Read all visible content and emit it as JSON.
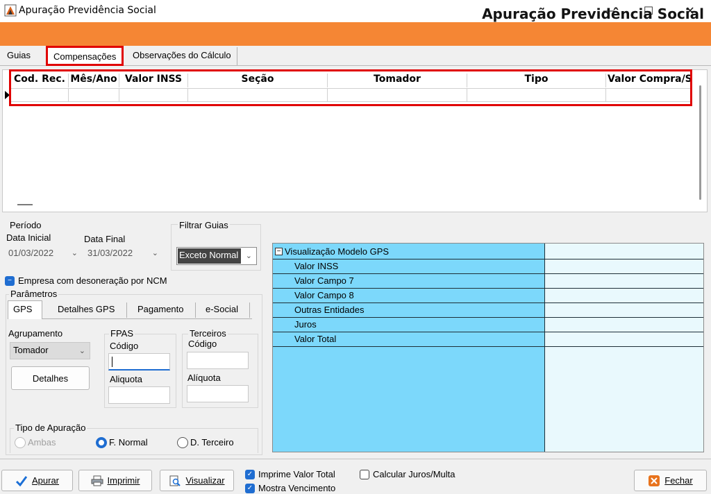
{
  "window": {
    "title": "Apuração Previdência Social",
    "minimize": "—",
    "maximize": "☐",
    "close": "✕"
  },
  "header": {
    "title": "Apuração Previdência Social"
  },
  "tabs": [
    {
      "label": "Guias"
    },
    {
      "label": "Compensações"
    },
    {
      "label": "Observações do Cálculo"
    }
  ],
  "grid": {
    "columns": [
      "Cod. Rec.",
      "Mês/Ano",
      "Valor INSS",
      "Seção",
      "Tomador",
      "Tipo",
      "Valor Compra/Se"
    ]
  },
  "periodo": {
    "label": "Período",
    "data_inicial_label": "Data Inicial",
    "data_inicial": "01/03/2022",
    "data_final_label": "Data Final",
    "data_final": "31/03/2022"
  },
  "filtrar": {
    "label": "Filtrar Guias",
    "value": "Exceto Normal"
  },
  "desoneracao": {
    "label": "Empresa com desoneração por NCM"
  },
  "parametros": {
    "label": "Parâmetros",
    "tabs": [
      "GPS",
      "Detalhes GPS",
      "Pagamento",
      "e-Social"
    ],
    "agrupamento_label": "Agrupamento",
    "agrupamento_value": "Tomador",
    "detalhes_button": "Detalhes",
    "fpas_label": "FPAS",
    "fpas_codigo_label": "Código",
    "fpas_aliquota_label": "Aliquota",
    "terceiros_label": "Terceiros",
    "terceiros_codigo_label": "Código",
    "terceiros_aliquota_label": "Alíquota",
    "tipo_label": "Tipo de Apuração",
    "tipo_options": [
      "Ambas",
      "F. Normal",
      "D. Terceiro"
    ]
  },
  "gps_view": {
    "root": "Visualização Modelo GPS",
    "collapse": "−",
    "rows": [
      "Valor INSS",
      "Valor Campo 7",
      "Valor Campo 8",
      "Outras Entidades",
      "Juros",
      "Valor Total"
    ]
  },
  "bottom": {
    "apurar": "Apurar",
    "imprimir": "Imprimir",
    "visualizar": "Visualizar",
    "imprime_total": "Imprime Valor Total",
    "mostra_vencimento": "Mostra Vencimento",
    "calcular_juros": "Calcular Juros/Multa",
    "fechar": "Fechar"
  }
}
